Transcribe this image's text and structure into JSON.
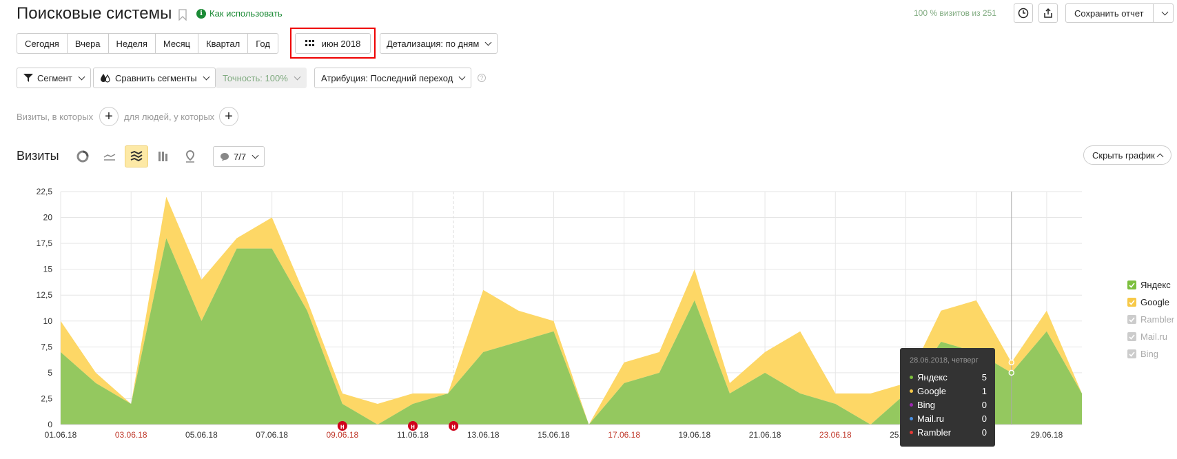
{
  "header": {
    "title": "Поисковые системы",
    "howto_label": "Как использовать",
    "visits_summary": "100 % визитов из 251",
    "save_report_label": "Сохранить отчет"
  },
  "period": {
    "options": [
      "Сегодня",
      "Вчера",
      "Неделя",
      "Месяц",
      "Квартал",
      "Год"
    ],
    "selected_range": "июн 2018",
    "detail_label": "Детализация: по дням"
  },
  "filters": {
    "segment_label": "Сегмент",
    "compare_label": "Сравнить сегменты",
    "accuracy_label": "Точность: 100%",
    "attribution_label": "Атрибуция: Последний переход"
  },
  "conditions": {
    "visits_where": "Визиты, в которых",
    "people_where": "для людей, у которых"
  },
  "chart_section": {
    "title": "Визиты",
    "annotations_count": "7/7",
    "hide_chart_label": "Скрыть график"
  },
  "legend": [
    {
      "name": "Яндекс",
      "color": "#7cbf3d",
      "checked": true,
      "enabled": true
    },
    {
      "name": "Google",
      "color": "#f7c948",
      "checked": true,
      "enabled": true
    },
    {
      "name": "Rambler",
      "color": "#cccccc",
      "checked": true,
      "enabled": false
    },
    {
      "name": "Mail.ru",
      "color": "#cccccc",
      "checked": true,
      "enabled": false
    },
    {
      "name": "Bing",
      "color": "#cccccc",
      "checked": true,
      "enabled": false
    }
  ],
  "tooltip": {
    "date": "28.06.2018, четверг",
    "rows": [
      {
        "name": "Яндекс",
        "value": "5",
        "color": "#7cbf3d"
      },
      {
        "name": "Google",
        "value": "1",
        "color": "#f7c948"
      },
      {
        "name": "Bing",
        "value": "0",
        "color": "#9c27b0"
      },
      {
        "name": "Mail.ru",
        "value": "0",
        "color": "#4a90e2"
      },
      {
        "name": "Rambler",
        "value": "0",
        "color": "#e53935"
      }
    ]
  },
  "chart_data": {
    "type": "area",
    "stacked": true,
    "x": [
      "01.06.18",
      "02.06.18",
      "03.06.18",
      "04.06.18",
      "05.06.18",
      "06.06.18",
      "07.06.18",
      "08.06.18",
      "09.06.18",
      "10.06.18",
      "11.06.18",
      "12.06.18",
      "13.06.18",
      "14.06.18",
      "15.06.18",
      "16.06.18",
      "17.06.18",
      "18.06.18",
      "19.06.18",
      "20.06.18",
      "21.06.18",
      "22.06.18",
      "23.06.18",
      "24.06.18",
      "25.06.18",
      "26.06.18",
      "27.06.18",
      "28.06.18",
      "29.06.18",
      "30.06.18"
    ],
    "x_tick_labels": [
      "01.06.18",
      "03.06.18",
      "05.06.18",
      "07.06.18",
      "09.06.18",
      "11.06.18",
      "13.06.18",
      "15.06.18",
      "17.06.18",
      "19.06.18",
      "21.06.18",
      "23.06.18",
      "25.06.18",
      "27.06.18",
      "29.06.18"
    ],
    "weekend_ticks": [
      "03.06.18",
      "09.06.18",
      "17.06.18",
      "23.06.18"
    ],
    "series": [
      {
        "name": "Яндекс",
        "color": "#94c85f",
        "values": [
          7,
          4,
          2,
          18,
          10,
          17,
          17,
          11,
          2,
          0,
          2,
          3,
          7,
          8,
          9,
          0,
          4,
          5,
          12,
          3,
          5,
          3,
          2,
          0,
          3,
          8,
          7,
          5,
          9,
          3
        ]
      },
      {
        "name": "Google",
        "color": "#fdd766",
        "values": [
          3,
          1,
          0,
          4,
          4,
          1,
          3,
          1,
          1,
          2,
          1,
          0,
          6,
          3,
          1,
          0,
          2,
          2,
          3,
          1,
          2,
          6,
          1,
          3,
          1,
          3,
          5,
          1,
          2,
          0
        ]
      }
    ],
    "ylim": [
      0,
      22.5
    ],
    "y_ticks": [
      "0",
      "2,5",
      "5",
      "7,5",
      "10",
      "12,5",
      "15",
      "17,5",
      "20",
      "22,5"
    ],
    "grid": true,
    "legend_position": "right",
    "annotation_markers": [
      "09.06.18",
      "11.06.18",
      "12.06.18"
    ],
    "annotation_marker_label": "н",
    "hover_x": "28.06.18"
  }
}
